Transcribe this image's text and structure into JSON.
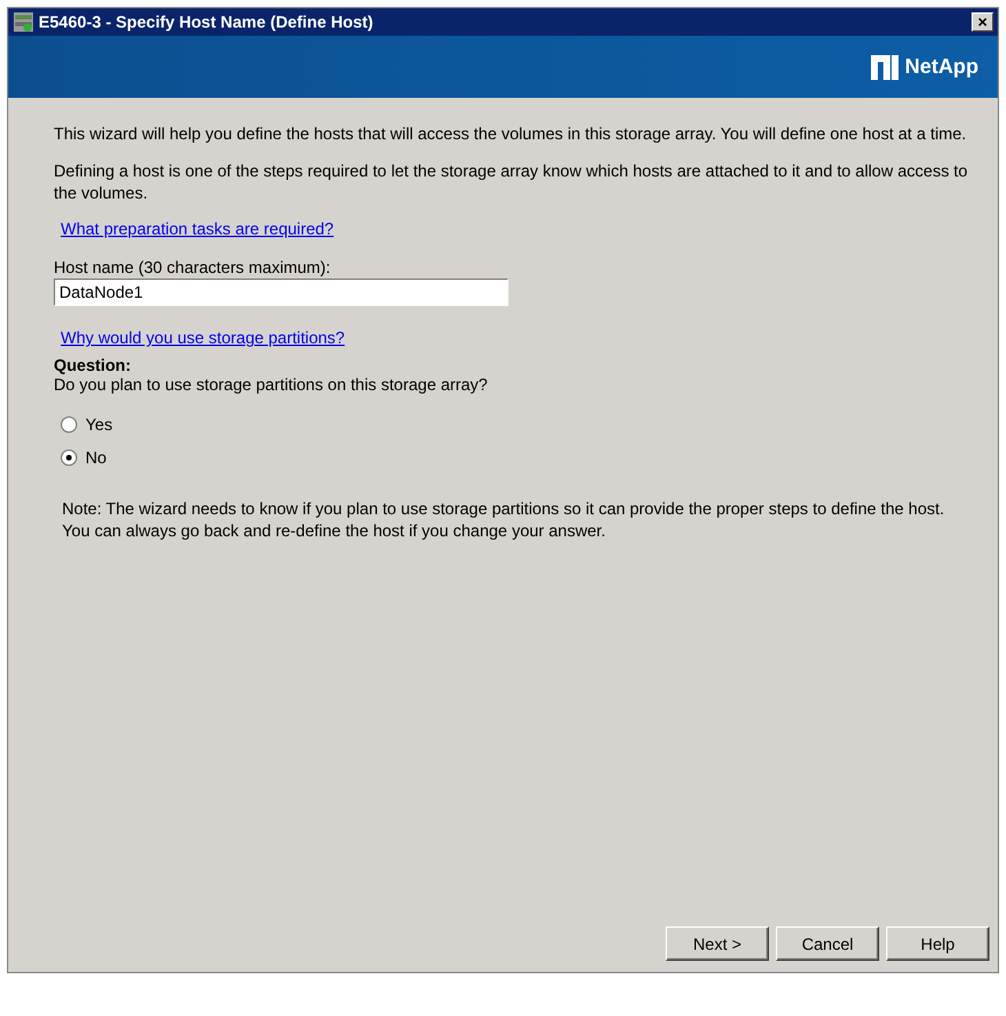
{
  "window": {
    "title": "E5460-3 - Specify Host Name (Define Host)",
    "close_button": "×"
  },
  "banner": {
    "logo_text": "NetApp"
  },
  "intro": "This wizard will help you define the hosts that will access the volumes in this storage array.  You will define one host at a time.",
  "description": "Defining a host is one of the steps required to let the storage array know which hosts are attached to it and to allow access to the volumes.",
  "link_preparation": "What preparation tasks are required?",
  "host_name": {
    "label": "Host name (30 characters maximum):",
    "value": "DataNode1"
  },
  "link_partitions": "Why would you use storage partitions?",
  "question": {
    "heading": "Question:",
    "text": "Do you plan to use storage partitions on this storage array?"
  },
  "options": [
    {
      "label": "Yes",
      "selected": false
    },
    {
      "label": "No",
      "selected": true
    }
  ],
  "note": "Note: The wizard needs to know if you plan to use storage partitions so it can provide the proper steps to define the host.  You can always go back and re-define the host if you change your answer.",
  "buttons": [
    "Next >",
    "Cancel",
    "Help"
  ]
}
